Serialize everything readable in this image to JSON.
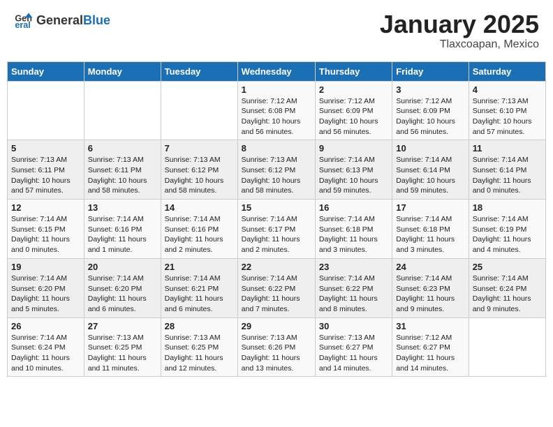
{
  "header": {
    "logo_general": "General",
    "logo_blue": "Blue",
    "month": "January 2025",
    "location": "Tlaxcoapan, Mexico"
  },
  "days_of_week": [
    "Sunday",
    "Monday",
    "Tuesday",
    "Wednesday",
    "Thursday",
    "Friday",
    "Saturday"
  ],
  "weeks": [
    [
      {
        "day": "",
        "info": ""
      },
      {
        "day": "",
        "info": ""
      },
      {
        "day": "",
        "info": ""
      },
      {
        "day": "1",
        "info": "Sunrise: 7:12 AM\nSunset: 6:08 PM\nDaylight: 10 hours\nand 56 minutes."
      },
      {
        "day": "2",
        "info": "Sunrise: 7:12 AM\nSunset: 6:09 PM\nDaylight: 10 hours\nand 56 minutes."
      },
      {
        "day": "3",
        "info": "Sunrise: 7:12 AM\nSunset: 6:09 PM\nDaylight: 10 hours\nand 56 minutes."
      },
      {
        "day": "4",
        "info": "Sunrise: 7:13 AM\nSunset: 6:10 PM\nDaylight: 10 hours\nand 57 minutes."
      }
    ],
    [
      {
        "day": "5",
        "info": "Sunrise: 7:13 AM\nSunset: 6:11 PM\nDaylight: 10 hours\nand 57 minutes."
      },
      {
        "day": "6",
        "info": "Sunrise: 7:13 AM\nSunset: 6:11 PM\nDaylight: 10 hours\nand 58 minutes."
      },
      {
        "day": "7",
        "info": "Sunrise: 7:13 AM\nSunset: 6:12 PM\nDaylight: 10 hours\nand 58 minutes."
      },
      {
        "day": "8",
        "info": "Sunrise: 7:13 AM\nSunset: 6:12 PM\nDaylight: 10 hours\nand 58 minutes."
      },
      {
        "day": "9",
        "info": "Sunrise: 7:14 AM\nSunset: 6:13 PM\nDaylight: 10 hours\nand 59 minutes."
      },
      {
        "day": "10",
        "info": "Sunrise: 7:14 AM\nSunset: 6:14 PM\nDaylight: 10 hours\nand 59 minutes."
      },
      {
        "day": "11",
        "info": "Sunrise: 7:14 AM\nSunset: 6:14 PM\nDaylight: 11 hours\nand 0 minutes."
      }
    ],
    [
      {
        "day": "12",
        "info": "Sunrise: 7:14 AM\nSunset: 6:15 PM\nDaylight: 11 hours\nand 0 minutes."
      },
      {
        "day": "13",
        "info": "Sunrise: 7:14 AM\nSunset: 6:16 PM\nDaylight: 11 hours\nand 1 minute."
      },
      {
        "day": "14",
        "info": "Sunrise: 7:14 AM\nSunset: 6:16 PM\nDaylight: 11 hours\nand 2 minutes."
      },
      {
        "day": "15",
        "info": "Sunrise: 7:14 AM\nSunset: 6:17 PM\nDaylight: 11 hours\nand 2 minutes."
      },
      {
        "day": "16",
        "info": "Sunrise: 7:14 AM\nSunset: 6:18 PM\nDaylight: 11 hours\nand 3 minutes."
      },
      {
        "day": "17",
        "info": "Sunrise: 7:14 AM\nSunset: 6:18 PM\nDaylight: 11 hours\nand 3 minutes."
      },
      {
        "day": "18",
        "info": "Sunrise: 7:14 AM\nSunset: 6:19 PM\nDaylight: 11 hours\nand 4 minutes."
      }
    ],
    [
      {
        "day": "19",
        "info": "Sunrise: 7:14 AM\nSunset: 6:20 PM\nDaylight: 11 hours\nand 5 minutes."
      },
      {
        "day": "20",
        "info": "Sunrise: 7:14 AM\nSunset: 6:20 PM\nDaylight: 11 hours\nand 6 minutes."
      },
      {
        "day": "21",
        "info": "Sunrise: 7:14 AM\nSunset: 6:21 PM\nDaylight: 11 hours\nand 6 minutes."
      },
      {
        "day": "22",
        "info": "Sunrise: 7:14 AM\nSunset: 6:22 PM\nDaylight: 11 hours\nand 7 minutes."
      },
      {
        "day": "23",
        "info": "Sunrise: 7:14 AM\nSunset: 6:22 PM\nDaylight: 11 hours\nand 8 minutes."
      },
      {
        "day": "24",
        "info": "Sunrise: 7:14 AM\nSunset: 6:23 PM\nDaylight: 11 hours\nand 9 minutes."
      },
      {
        "day": "25",
        "info": "Sunrise: 7:14 AM\nSunset: 6:24 PM\nDaylight: 11 hours\nand 9 minutes."
      }
    ],
    [
      {
        "day": "26",
        "info": "Sunrise: 7:14 AM\nSunset: 6:24 PM\nDaylight: 11 hours\nand 10 minutes."
      },
      {
        "day": "27",
        "info": "Sunrise: 7:13 AM\nSunset: 6:25 PM\nDaylight: 11 hours\nand 11 minutes."
      },
      {
        "day": "28",
        "info": "Sunrise: 7:13 AM\nSunset: 6:25 PM\nDaylight: 11 hours\nand 12 minutes."
      },
      {
        "day": "29",
        "info": "Sunrise: 7:13 AM\nSunset: 6:26 PM\nDaylight: 11 hours\nand 13 minutes."
      },
      {
        "day": "30",
        "info": "Sunrise: 7:13 AM\nSunset: 6:27 PM\nDaylight: 11 hours\nand 14 minutes."
      },
      {
        "day": "31",
        "info": "Sunrise: 7:12 AM\nSunset: 6:27 PM\nDaylight: 11 hours\nand 14 minutes."
      },
      {
        "day": "",
        "info": ""
      }
    ]
  ]
}
